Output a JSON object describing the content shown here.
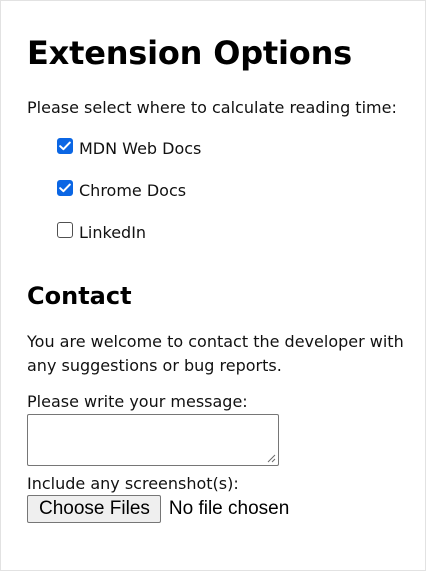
{
  "page": {
    "title": "Extension Options",
    "lead": "Please select where to calculate reading time:"
  },
  "sites": [
    {
      "label": "MDN Web Docs",
      "checked": true
    },
    {
      "label": "Chrome Docs",
      "checked": true
    },
    {
      "label": "LinkedIn",
      "checked": false
    }
  ],
  "contact": {
    "heading": "Contact",
    "text": "You are welcome to contact the developer with any suggestions or bug reports.",
    "message_label": "Please write your message:",
    "message_value": "",
    "screenshot_label": "Include any screenshot(s):",
    "file_button": "Choose Files",
    "file_status": "No file chosen"
  },
  "colors": {
    "checkbox_checked": "#0b66e4",
    "checkbox_border": "#505050",
    "button_bg": "#efefef"
  },
  "icons": {
    "checkmark": "check-icon",
    "resize": "resize-grip-icon"
  }
}
